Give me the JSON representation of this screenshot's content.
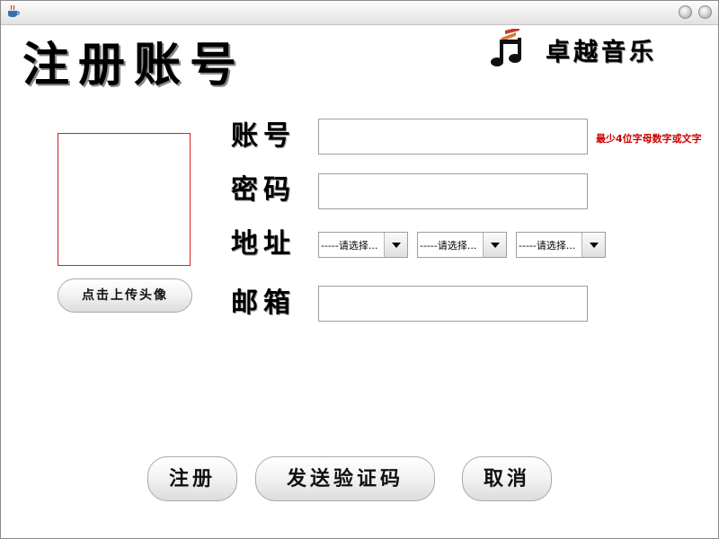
{
  "window": {
    "app_icon": "java-cup-icon",
    "controls": [
      "minimize-button",
      "close-button"
    ]
  },
  "header": {
    "title": "注册账号",
    "brand_icon": "music-notes-icon",
    "brand_name": "卓越音乐"
  },
  "avatar": {
    "upload_label": "点击上传头像"
  },
  "form": {
    "account_label": "账号",
    "account_value": "",
    "account_hint": "最少4位字母数字或文字",
    "password_label": "密码",
    "password_value": "",
    "address_label": "地址",
    "address_selects": [
      "-----请选择...",
      "-----请选择...",
      "-----请选择..."
    ],
    "email_label": "邮箱",
    "email_value": ""
  },
  "actions": {
    "register": "注册",
    "send_code": "发送验证码",
    "cancel": "取消"
  },
  "colors": {
    "hint": "#cc0000",
    "avatar_border": "#d42020"
  }
}
